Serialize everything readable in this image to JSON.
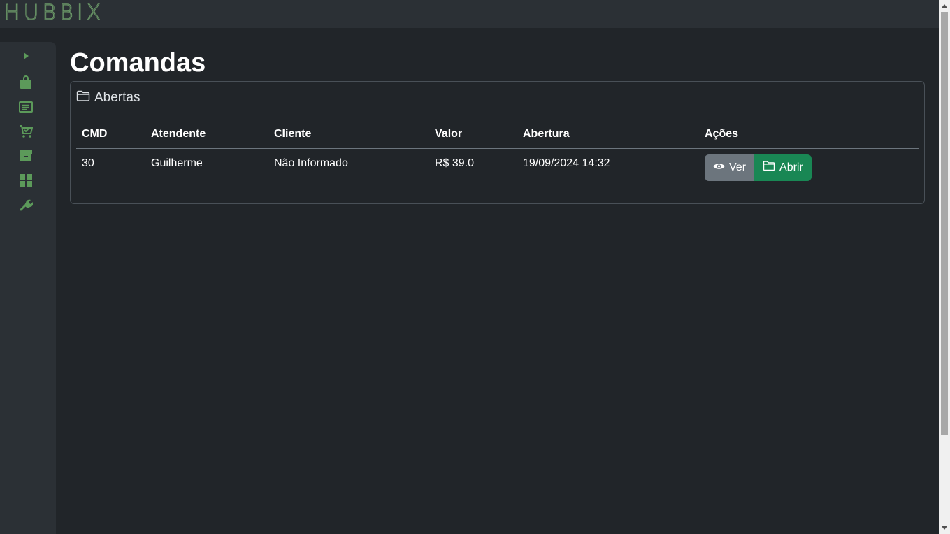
{
  "app": {
    "logo": "HUBBIX"
  },
  "sidebar": {
    "icons": [
      "expand-arrow-icon",
      "shopping-bag-icon",
      "receipt-icon",
      "cart-check-icon",
      "archive-icon",
      "grid-icon",
      "wrench-icon"
    ],
    "accent": "#5c9a5a"
  },
  "page": {
    "title": "Comandas"
  },
  "card": {
    "title": "Abertas"
  },
  "table": {
    "headers": [
      "CMD",
      "Atendente",
      "Cliente",
      "Valor",
      "Abertura",
      "Ações"
    ],
    "rows": [
      {
        "cmd": "30",
        "atendente": "Guilherme",
        "cliente": "Não Informado",
        "valor": "R$ 39.0",
        "abertura": "19/09/2024 14:32"
      }
    ]
  },
  "actions": {
    "view_label": "Ver",
    "open_label": "Abrir"
  },
  "colors": {
    "view_button": "#6c757d",
    "open_button": "#198754",
    "background": "#212529"
  }
}
